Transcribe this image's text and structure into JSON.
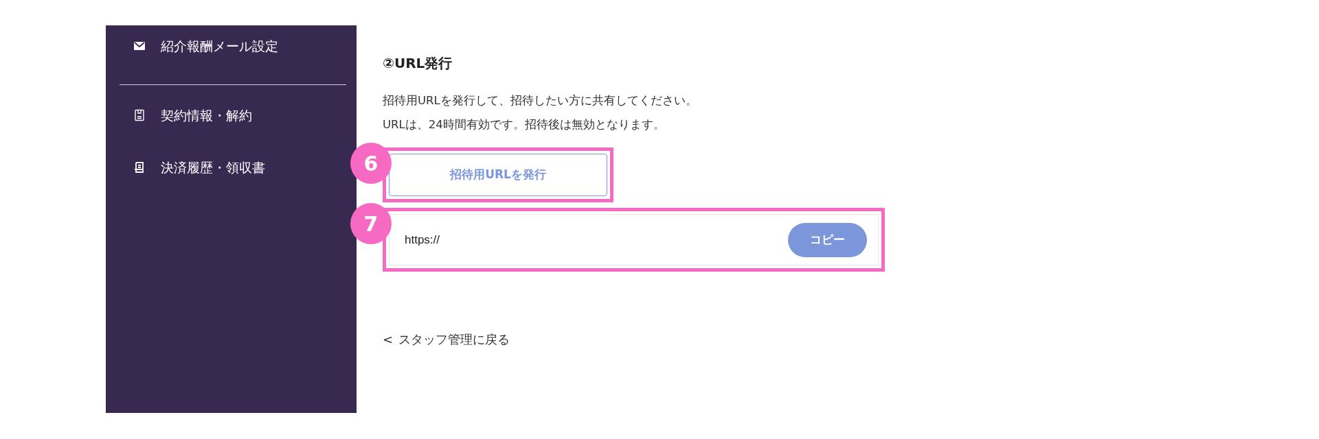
{
  "sidebar": {
    "items": [
      {
        "kind": "mail",
        "label": "紹介報酬メール設定"
      },
      {
        "kind": "divider"
      },
      {
        "kind": "contract",
        "label": "契約情報・解約"
      },
      {
        "kind": "receipt",
        "label": "決済履歴・領収書"
      }
    ]
  },
  "section": {
    "title": "②URL発行",
    "description": [
      "招待用URLを発行して、招待したい方に共有してください。",
      "URLは、24時間有効です。招待後は無効となります。"
    ],
    "issue_button": {
      "label": "招待用URLを発行",
      "callout": "6"
    },
    "url_field": {
      "value": "https://",
      "copy_button": "コピー",
      "callout": "7"
    }
  },
  "back_link": {
    "arrow": "<",
    "label": "スタッフ管理に戻る"
  }
}
